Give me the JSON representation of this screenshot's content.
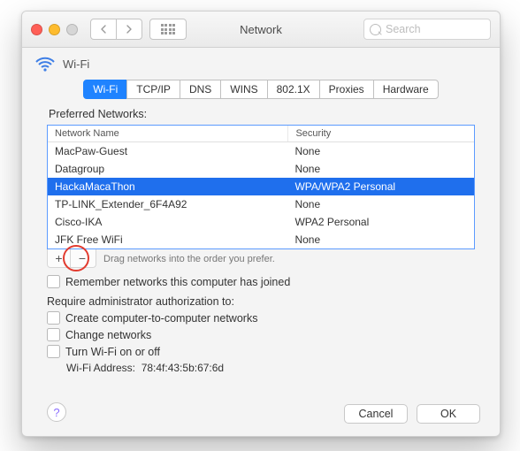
{
  "window": {
    "title": "Network"
  },
  "search": {
    "placeholder": "Search"
  },
  "header": {
    "label": "Wi-Fi"
  },
  "tabs": [
    "Wi-Fi",
    "TCP/IP",
    "DNS",
    "WINS",
    "802.1X",
    "Proxies",
    "Hardware"
  ],
  "active_tab": 0,
  "section_label": "Preferred Networks:",
  "columns": {
    "name": "Network Name",
    "security": "Security"
  },
  "networks": [
    {
      "name": "MacPaw-Guest",
      "security": "None",
      "selected": false
    },
    {
      "name": "Datagroup",
      "security": "None",
      "selected": false
    },
    {
      "name": "HackaMacaThon",
      "security": "WPA/WPA2 Personal",
      "selected": true
    },
    {
      "name": "TP-LINK_Extender_6F4A92",
      "security": "None",
      "selected": false
    },
    {
      "name": "Cisco-IKA",
      "security": "WPA2 Personal",
      "selected": false
    },
    {
      "name": "JFK Free WiFi",
      "security": "None",
      "selected": false
    }
  ],
  "drag_hint": "Drag networks into the order you prefer.",
  "remember_label": "Remember networks this computer has joined",
  "admin_label": "Require administrator authorization to:",
  "admin_opts": {
    "c2c": "Create computer-to-computer networks",
    "change": "Change networks",
    "toggle": "Turn Wi-Fi on or off"
  },
  "wifi_addr_label": "Wi-Fi Address:",
  "wifi_addr": "78:4f:43:5b:67:6d",
  "buttons": {
    "cancel": "Cancel",
    "ok": "OK"
  },
  "addrem": {
    "add": "+",
    "remove": "−"
  }
}
